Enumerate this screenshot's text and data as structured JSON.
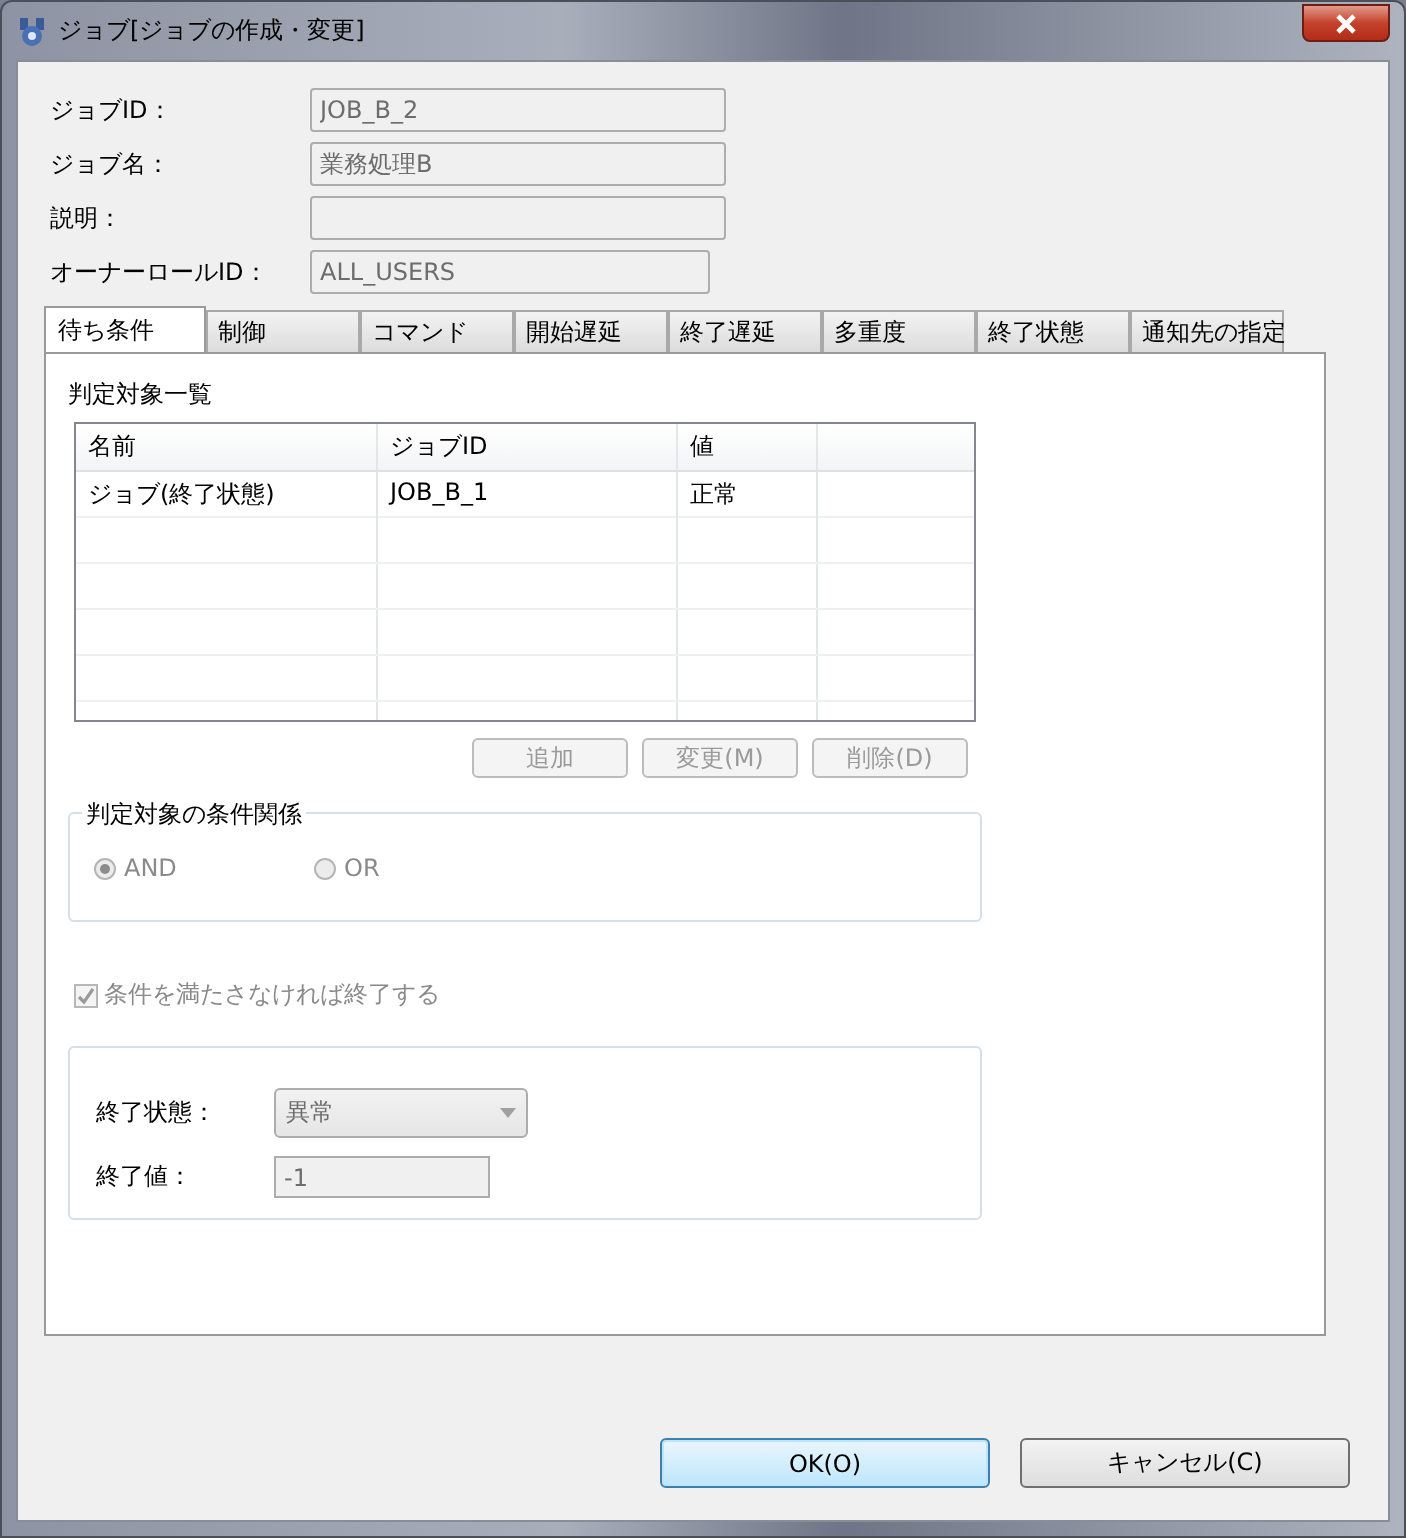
{
  "window": {
    "title": "ジョブ[ジョブの作成・変更]"
  },
  "fields": [
    {
      "label": "ジョブID：",
      "value": "JOB_B_2",
      "disabled": true
    },
    {
      "label": "ジョブ名：",
      "value": "業務処理B",
      "disabled": true
    },
    {
      "label": "説明：",
      "disabled": true
    },
    {
      "label": "オーナーロールID：",
      "value": "ALL_USERS",
      "disabled": true
    }
  ],
  "tabs": [
    {
      "label": "待ち条件",
      "selected": true
    },
    {
      "label": "制御",
      "selected": false
    },
    {
      "label": "コマンド",
      "selected": false
    },
    {
      "label": "開始遅延",
      "selected": false
    },
    {
      "label": "終了遅延",
      "selected": false
    },
    {
      "label": "多重度",
      "selected": false
    },
    {
      "label": "終了状態",
      "selected": false
    },
    {
      "label": "通知先の指定",
      "selected": false
    }
  ],
  "list_title": "判定対象一覧",
  "table": {
    "columns": [
      "名前",
      "ジョブID",
      "値"
    ],
    "rows": [
      [
        "ジョブ(終了状態)",
        "JOB_B_1",
        "正常"
      ]
    ]
  },
  "table_buttons": [
    {
      "label": "追加",
      "disabled": true
    },
    {
      "label": "変更(M)",
      "disabled": true
    },
    {
      "label": "削除(D)",
      "disabled": true
    }
  ],
  "condition_group": {
    "title": "判定対象の条件関係",
    "options": [
      {
        "label": "AND",
        "selected": true,
        "disabled": true
      },
      {
        "label": "OR",
        "selected": false,
        "disabled": true
      }
    ]
  },
  "end_checkbox": {
    "label": "条件を満たさなければ終了する",
    "checked": true,
    "disabled": true
  },
  "end_settings": [
    {
      "kind": "dropdown",
      "label": "終了状態：",
      "value": "異常",
      "disabled": true
    },
    {
      "kind": "text",
      "label": "終了値：",
      "value": "-1",
      "disabled": true
    }
  ],
  "buttons": [
    {
      "label": "OK(O)",
      "default": true
    },
    {
      "label": "キャンセル(C)",
      "default": false
    }
  ]
}
